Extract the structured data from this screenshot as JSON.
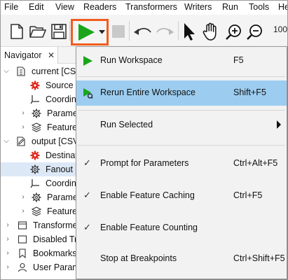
{
  "menubar": {
    "items": [
      "File",
      "Edit",
      "View",
      "Readers",
      "Transformers",
      "Writers",
      "Run",
      "Tools",
      "He"
    ]
  },
  "toolbar": {
    "zoom": "100"
  },
  "navigator": {
    "tab_label": "Navigator",
    "close_glyph": "✕",
    "items": [
      {
        "label": "current [CSV",
        "icon": "csv-reader-icon",
        "expanded": true,
        "level": 0
      },
      {
        "label": "Source C",
        "icon": "gear-red-icon",
        "level": 1
      },
      {
        "label": "Coordin",
        "icon": "coordinate-icon",
        "level": 1
      },
      {
        "label": "Paramet",
        "icon": "gear-icon",
        "level": 1,
        "collapsed": true
      },
      {
        "label": "Feature",
        "icon": "layers-icon",
        "level": 1,
        "collapsed": true
      },
      {
        "label": "output [CSV",
        "icon": "csv-writer-icon",
        "expanded": true,
        "level": 0
      },
      {
        "label": "Destinat",
        "icon": "gear-red-icon",
        "level": 1
      },
      {
        "label": "Fanout",
        "icon": "gear-icon",
        "level": 1,
        "selected": true
      },
      {
        "label": "Coordin",
        "icon": "coordinate-icon",
        "level": 1
      },
      {
        "label": "Paramet",
        "icon": "gear-icon",
        "level": 1,
        "collapsed": true
      },
      {
        "label": "Feature",
        "icon": "layers-icon",
        "level": 1,
        "collapsed": true
      },
      {
        "label": "Transformer",
        "icon": "transformer-icon",
        "level": 0,
        "collapsed": true
      },
      {
        "label": "Disabled Tra",
        "icon": "disabled-icon",
        "level": 0,
        "collapsed": true
      },
      {
        "label": "Bookmarks",
        "icon": "bookmark-icon",
        "level": 0,
        "collapsed": true
      },
      {
        "label": "User Param",
        "icon": "user-icon",
        "level": 0,
        "collapsed": true
      }
    ]
  },
  "run_menu": {
    "items": [
      {
        "label": "Run Workspace",
        "shortcut": "F5",
        "icon": "play-icon"
      },
      {
        "label": "Rerun Entire Workspace",
        "shortcut": "Shift+F5",
        "icon": "rerun-icon",
        "highlighted": true
      },
      {
        "label": "Run Selected",
        "shortcut": "",
        "submenu": true
      },
      {
        "label": "Prompt for Parameters",
        "shortcut": "Ctrl+Alt+F5",
        "checked": true
      },
      {
        "label": "Enable Feature Caching",
        "shortcut": "Ctrl+F5",
        "checked": true
      },
      {
        "label": "Enable Feature Counting",
        "shortcut": "",
        "checked": true
      },
      {
        "label": "Stop at Breakpoints",
        "shortcut": "Ctrl+Shift+F5",
        "checked": false
      }
    ],
    "check_glyph": "✓"
  },
  "colors": {
    "accent_orange": "#f25c1e",
    "play_green": "#1aa61a",
    "highlight_blue": "#9ccdf0",
    "gear_red": "#e0241a"
  }
}
